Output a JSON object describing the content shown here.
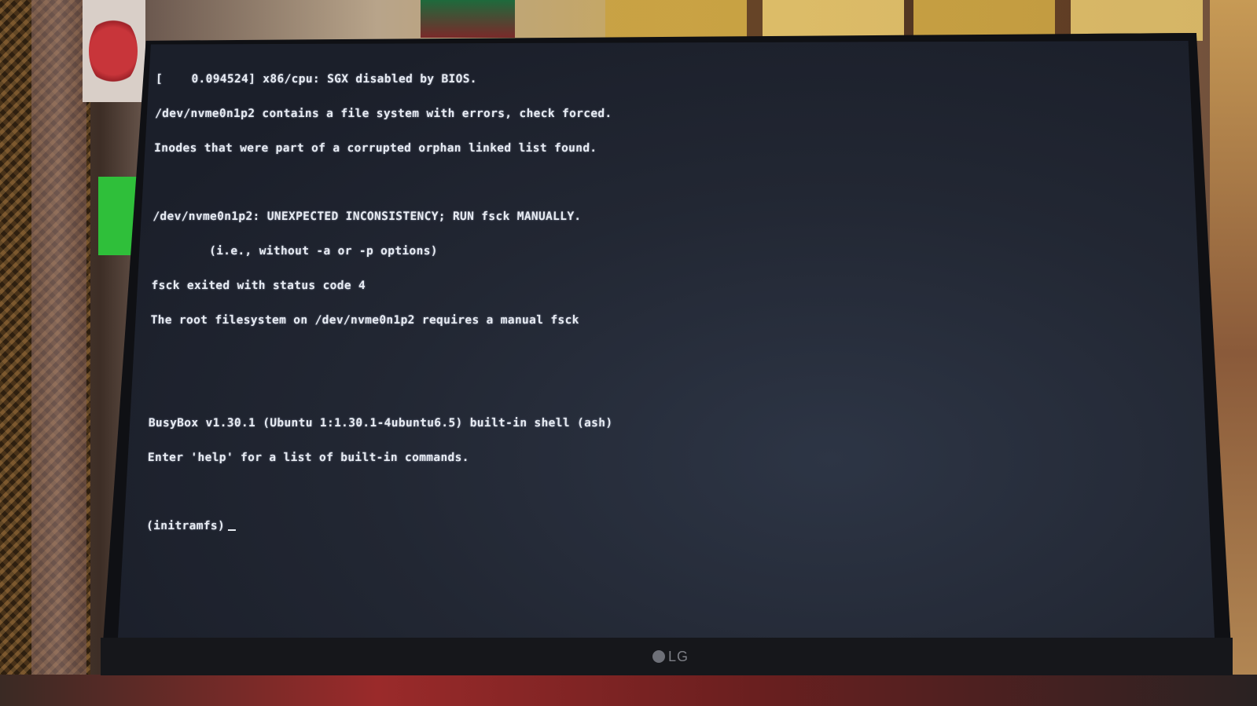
{
  "terminal": {
    "lines": [
      "[    0.094524] x86/cpu: SGX disabled by BIOS.",
      "/dev/nvme0n1p2 contains a file system with errors, check forced.",
      "Inodes that were part of a corrupted orphan linked list found.",
      "",
      "/dev/nvme0n1p2: UNEXPECTED INCONSISTENCY; RUN fsck MANUALLY.",
      "        (i.e., without -a or -p options)",
      "fsck exited with status code 4",
      "The root filesystem on /dev/nvme0n1p2 requires a manual fsck",
      "",
      "",
      "BusyBox v1.30.1 (Ubuntu 1:1.30.1-4ubuntu6.5) built-in shell (ash)",
      "Enter 'help' for a list of built-in commands.",
      ""
    ],
    "prompt": "(initramfs)"
  },
  "monitor": {
    "brand": "LG"
  },
  "colors": {
    "screen_bg": "#1f2430",
    "text": "#e7ebf2",
    "bezel": "#0f1014"
  }
}
